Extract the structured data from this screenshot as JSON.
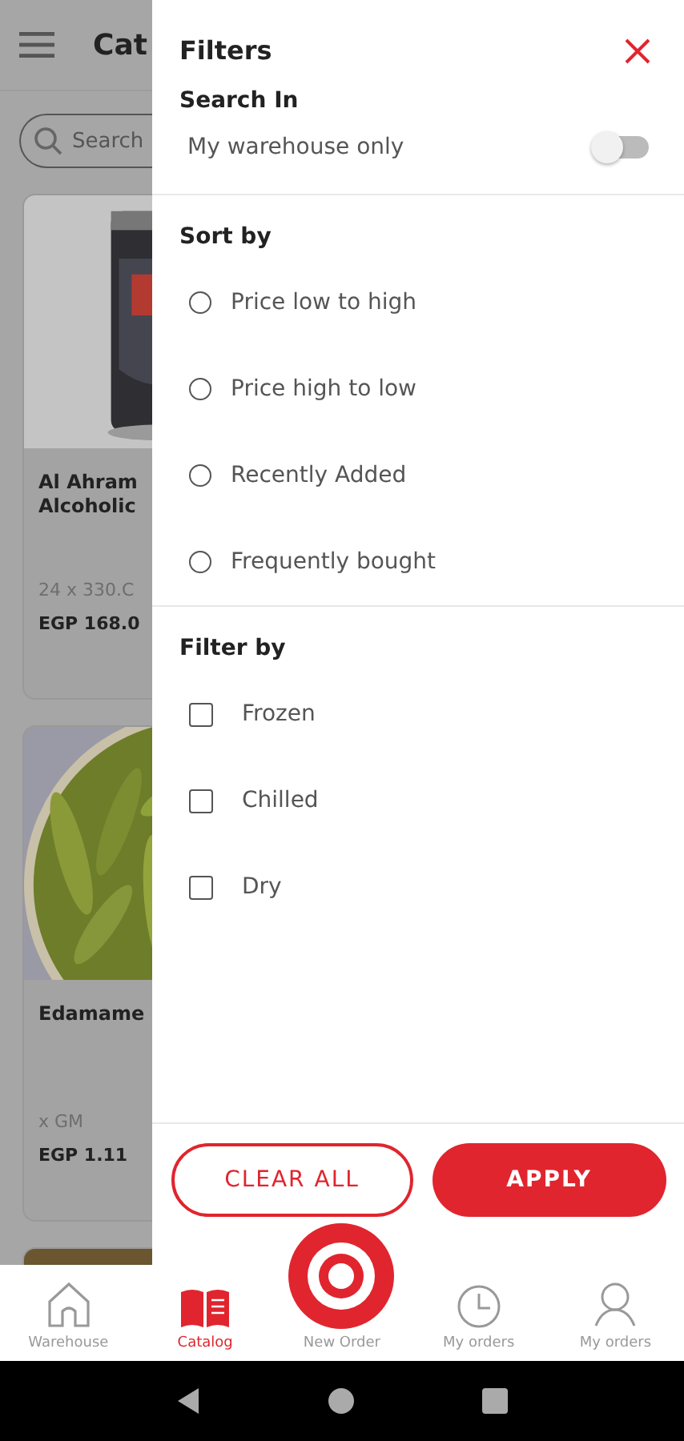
{
  "app_bar": {
    "title": "Cat"
  },
  "search": {
    "placeholder": "Search"
  },
  "products": [
    {
      "kind": "picture",
      "name": "Al Ahram\nAlcoholic",
      "pack": "24 x 330.C",
      "price": "EGP 168.0"
    },
    {
      "kind": "picture",
      "name": "Edamame",
      "pack": "x  GM",
      "price": "EGP 1.11"
    }
  ],
  "filters": {
    "title": "Filters",
    "search_in": {
      "heading": "Search In",
      "label": "My warehouse only",
      "on": false
    },
    "sort_by": {
      "heading": "Sort by",
      "options": [
        {
          "label": "Price low to high",
          "selected": false
        },
        {
          "label": "Price high to low",
          "selected": false
        },
        {
          "label": "Recently Added",
          "selected": false
        },
        {
          "label": "Frequently bought",
          "selected": false
        }
      ]
    },
    "filter_by": {
      "heading": "Filter by",
      "options": [
        {
          "label": "Frozen",
          "checked": false
        },
        {
          "label": "Chilled",
          "checked": false
        },
        {
          "label": "Dry",
          "checked": false
        }
      ]
    },
    "buttons": {
      "clear": "CLEAR ALL",
      "apply": "APPLY"
    }
  },
  "bottom_nav": [
    {
      "kind": "home",
      "label": "Warehouse",
      "selected": false
    },
    {
      "kind": "catalog",
      "label": "Catalog",
      "selected": true
    },
    {
      "kind": "order",
      "label": "New Order",
      "selected": false
    },
    {
      "kind": "clock",
      "label": "My orders",
      "selected": false
    },
    {
      "kind": "person",
      "label": "My orders",
      "selected": false
    }
  ]
}
